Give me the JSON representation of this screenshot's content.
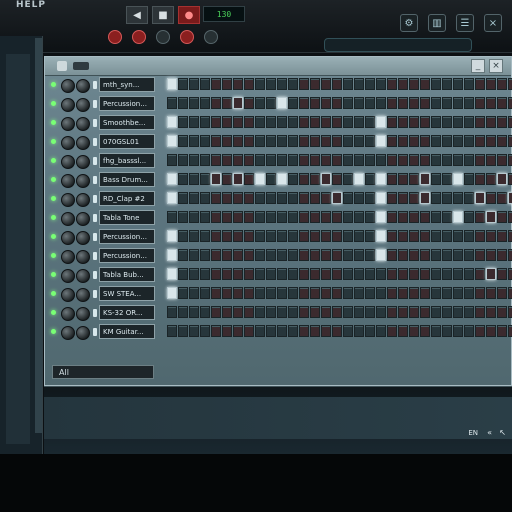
{
  "menu": {
    "help": "HELP"
  },
  "transport": {
    "buttons": [
      "◀",
      "■",
      "●"
    ],
    "tempo": "130"
  },
  "channel_rack": {
    "selector": "All",
    "channels": [
      {
        "name": "mth_syn...",
        "steps": [
          1,
          0,
          0,
          0,
          0,
          0,
          0,
          0,
          0,
          0,
          0,
          0,
          0,
          0,
          0,
          0,
          0,
          0,
          0,
          0,
          0,
          0,
          0,
          0,
          0,
          0,
          0,
          0,
          0,
          0,
          0,
          0
        ]
      },
      {
        "name": "Percussion...",
        "steps": [
          0,
          0,
          0,
          0,
          0,
          0,
          1,
          0,
          0,
          0,
          1,
          0,
          0,
          0,
          0,
          0,
          0,
          0,
          0,
          0,
          0,
          0,
          0,
          0,
          0,
          0,
          0,
          0,
          0,
          0,
          0,
          0
        ]
      },
      {
        "name": "Smoothbe...",
        "steps": [
          1,
          0,
          0,
          0,
          0,
          0,
          0,
          0,
          0,
          0,
          0,
          0,
          0,
          0,
          0,
          0,
          0,
          0,
          0,
          1,
          0,
          0,
          0,
          0,
          0,
          0,
          0,
          0,
          0,
          0,
          0,
          0
        ]
      },
      {
        "name": "070GSL01",
        "steps": [
          1,
          0,
          0,
          0,
          0,
          0,
          0,
          0,
          0,
          0,
          0,
          0,
          0,
          0,
          0,
          0,
          0,
          0,
          0,
          1,
          0,
          0,
          0,
          0,
          0,
          0,
          0,
          0,
          0,
          0,
          0,
          0
        ]
      },
      {
        "name": "fhg_basssl...",
        "steps": [
          0,
          0,
          0,
          0,
          0,
          0,
          0,
          0,
          0,
          0,
          0,
          0,
          0,
          0,
          0,
          0,
          0,
          0,
          0,
          0,
          0,
          0,
          0,
          0,
          0,
          0,
          0,
          0,
          0,
          0,
          0,
          0
        ]
      },
      {
        "name": "Bass Drum...",
        "steps": [
          1,
          0,
          0,
          0,
          1,
          0,
          1,
          0,
          1,
          0,
          1,
          0,
          0,
          0,
          1,
          0,
          0,
          1,
          0,
          1,
          0,
          0,
          0,
          1,
          0,
          0,
          1,
          0,
          0,
          0,
          1,
          0
        ]
      },
      {
        "name": "RD_Clap #2",
        "steps": [
          1,
          0,
          0,
          0,
          0,
          0,
          0,
          0,
          0,
          0,
          0,
          0,
          0,
          0,
          0,
          1,
          0,
          0,
          0,
          1,
          0,
          0,
          0,
          1,
          0,
          0,
          0,
          0,
          1,
          0,
          0,
          1
        ]
      },
      {
        "name": "Tabla Tone",
        "steps": [
          0,
          0,
          0,
          0,
          0,
          0,
          0,
          0,
          0,
          0,
          0,
          0,
          0,
          0,
          0,
          0,
          0,
          0,
          0,
          1,
          0,
          0,
          0,
          0,
          0,
          0,
          1,
          0,
          0,
          1,
          0,
          0
        ]
      },
      {
        "name": "Percussion...",
        "steps": [
          1,
          0,
          0,
          0,
          0,
          0,
          0,
          0,
          0,
          0,
          0,
          0,
          0,
          0,
          0,
          0,
          0,
          0,
          0,
          1,
          0,
          0,
          0,
          0,
          0,
          0,
          0,
          0,
          0,
          0,
          0,
          0
        ]
      },
      {
        "name": "Percussion...",
        "steps": [
          1,
          0,
          0,
          0,
          0,
          0,
          0,
          0,
          0,
          0,
          0,
          0,
          0,
          0,
          0,
          0,
          0,
          0,
          0,
          1,
          0,
          0,
          0,
          0,
          0,
          0,
          0,
          0,
          0,
          0,
          0,
          0
        ]
      },
      {
        "name": "Tabla Bub...",
        "steps": [
          1,
          0,
          0,
          0,
          0,
          0,
          0,
          0,
          0,
          0,
          0,
          0,
          0,
          0,
          0,
          0,
          0,
          0,
          0,
          0,
          0,
          0,
          0,
          0,
          0,
          0,
          0,
          0,
          0,
          1,
          0,
          0
        ]
      },
      {
        "name": "SW STEA...",
        "steps": [
          1,
          0,
          0,
          0,
          0,
          0,
          0,
          0,
          0,
          0,
          0,
          0,
          0,
          0,
          0,
          0,
          0,
          0,
          0,
          0,
          0,
          0,
          0,
          0,
          0,
          0,
          0,
          0,
          0,
          0,
          0,
          0
        ]
      },
      {
        "name": "KS-32 OR...",
        "steps": [
          0,
          0,
          0,
          0,
          0,
          0,
          0,
          0,
          0,
          0,
          0,
          0,
          0,
          0,
          0,
          0,
          0,
          0,
          0,
          0,
          0,
          0,
          0,
          0,
          0,
          0,
          0,
          0,
          0,
          0,
          0,
          0
        ]
      },
      {
        "name": "KM Guitar...",
        "steps": [
          0,
          0,
          0,
          0,
          0,
          0,
          0,
          0,
          0,
          0,
          0,
          0,
          0,
          0,
          0,
          0,
          0,
          0,
          0,
          0,
          0,
          0,
          0,
          0,
          0,
          0,
          0,
          0,
          0,
          0,
          0,
          0
        ]
      }
    ]
  },
  "system_tray": {
    "language": "EN",
    "icon_1": "«",
    "icon_2": "↖"
  },
  "icons": [
    "play-icon",
    "stop-icon",
    "record-icon",
    "settings-icon",
    "mixer-icon",
    "browser-icon",
    "close-icon"
  ],
  "colors": {
    "rack_bg": "#5d7680",
    "step_on": "#d9e6ea",
    "step_off": "#27363b",
    "led": "#79ff75",
    "tempo_text": "#4bd15b"
  }
}
